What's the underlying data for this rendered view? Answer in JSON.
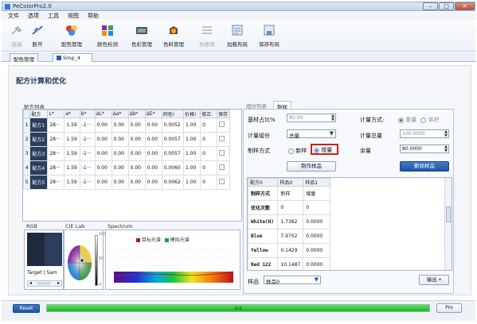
{
  "window": {
    "title": "PeColorPro2.0",
    "controls": [
      "–",
      "□",
      "✕"
    ]
  },
  "menu": [
    "文件",
    "选项",
    "工具",
    "视图",
    "帮助"
  ],
  "toolbar": [
    {
      "label": "连接",
      "icon": "plug-icon",
      "disabled": true
    },
    {
      "label": "断开",
      "icon": "unplug-icon",
      "disabled": false
    },
    {
      "label": "配色管理",
      "icon": "color-match-icon",
      "disabled": false
    },
    {
      "label": "颜色检测",
      "icon": "color-detect-icon",
      "disabled": false
    },
    {
      "label": "色彩管理",
      "icon": "color-manage-icon",
      "disabled": false
    },
    {
      "label": "色料管理",
      "icon": "colorant-manage-icon",
      "disabled": false
    },
    {
      "label": "列表项",
      "icon": "list-items-icon",
      "disabled": true
    },
    {
      "label": "加载布局",
      "icon": "load-layout-icon",
      "disabled": false
    },
    {
      "label": "保存布局",
      "icon": "save-layout-icon",
      "disabled": false
    }
  ],
  "doc_tabs": [
    "配色管理",
    "Smp_4"
  ],
  "section_title": "配方计算和优化",
  "formula_list": {
    "label": "配方列表",
    "headers": [
      "配方",
      "L*",
      "a*",
      "b*",
      "ΔL*",
      "Δa*",
      "Δb*",
      "ΔE*",
      "同色!",
      "价格!",
      "修正:",
      "保存"
    ],
    "rows": [
      {
        "num": "1",
        "name": "配方1",
        "L": "28···",
        "a": "1.59",
        "b": "-1···",
        "dL": "0.00",
        "da": "0.00",
        "db": "0.00",
        "dE": "0.00",
        "meta": "0.0052",
        "price": "1.00",
        "fix": "0"
      },
      {
        "num": "2",
        "name": "配方2",
        "L": "28···",
        "a": "1.59",
        "b": "-1···",
        "dL": "0.00",
        "da": "0.00",
        "db": "0.00",
        "dE": "0.00",
        "meta": "0.0057",
        "price": "1.00",
        "fix": "0"
      },
      {
        "num": "3",
        "name": "配方3",
        "L": "28···",
        "a": "1.59",
        "b": "-1···",
        "dL": "0.00",
        "da": "0.00",
        "db": "0.00",
        "dE": "0.00",
        "meta": "0.0057",
        "price": "1.00",
        "fix": "0"
      },
      {
        "num": "4",
        "name": "配方4",
        "L": "28···",
        "a": "1.59",
        "b": "-1···",
        "dL": "0.00",
        "da": "0.00",
        "db": "0.00",
        "dE": "0.00",
        "meta": "0.0060",
        "price": "1.00",
        "fix": "0"
      },
      {
        "num": "5",
        "name": "配方5",
        "L": "28···",
        "a": "1.59",
        "b": "-1···",
        "dL": "0.00",
        "da": "0.00",
        "db": "0.00",
        "dE": "0.00",
        "meta": "0.0062",
        "price": "1.00",
        "fix": "0"
      }
    ]
  },
  "previews": {
    "rgb_label": "RGB",
    "rgb_caption": "Target | Sam",
    "lab_label": "CIE Lab",
    "lab_ticks": [
      "100",
      "50",
      "0"
    ],
    "spectrum_label": "Spectrum",
    "legend_target": "目标光谱",
    "legend_sim": "模拟光谱",
    "colors": {
      "target": "#1e2a3c",
      "sample": "#2b3d5d",
      "target_legend": "#b0182a",
      "sim_legend": "#17a34a"
    }
  },
  "right_panel": {
    "tabs": [
      "组份列表",
      "制样"
    ],
    "base_ratio_label": "基材占比%",
    "base_ratio_value": "80.00",
    "calc_mode_label": "计量方式:",
    "calc_mode_options": [
      "重量",
      "体积"
    ],
    "calc_group_label": "计量组份",
    "calc_group_value": "总量",
    "calc_total_label": "计量总量",
    "calc_total_value": "100.0000",
    "sample_mode_label": "制样方式",
    "sample_mode_options": [
      "新样",
      "增量"
    ],
    "remain_label": "余量",
    "remain_value": "80.0000",
    "make_sample_btn": "制作样品",
    "delete_sample_btn": "删除样品",
    "table_headers": [
      "配方0",
      "样品0",
      "样品1"
    ],
    "table_rows": [
      [
        "制样方式",
        "新样",
        "增量"
      ],
      [
        "优化次数",
        "0",
        "0"
      ],
      [
        "White(H)",
        "1.7382",
        "0.0000"
      ],
      [
        "Blue",
        "7.9702",
        "0.0000"
      ],
      [
        "Yellow",
        "0.1429",
        "0.0000"
      ],
      [
        "Red 122",
        "10.1487",
        "0.0000"
      ]
    ],
    "sample_label": "样品",
    "sample_value": "样品0",
    "export_btn": "输出"
  },
  "status": {
    "reset_btn": "Reset",
    "progress_text": "4/4",
    "progress_fraction": 1.0,
    "pro_btn": "Pro"
  }
}
